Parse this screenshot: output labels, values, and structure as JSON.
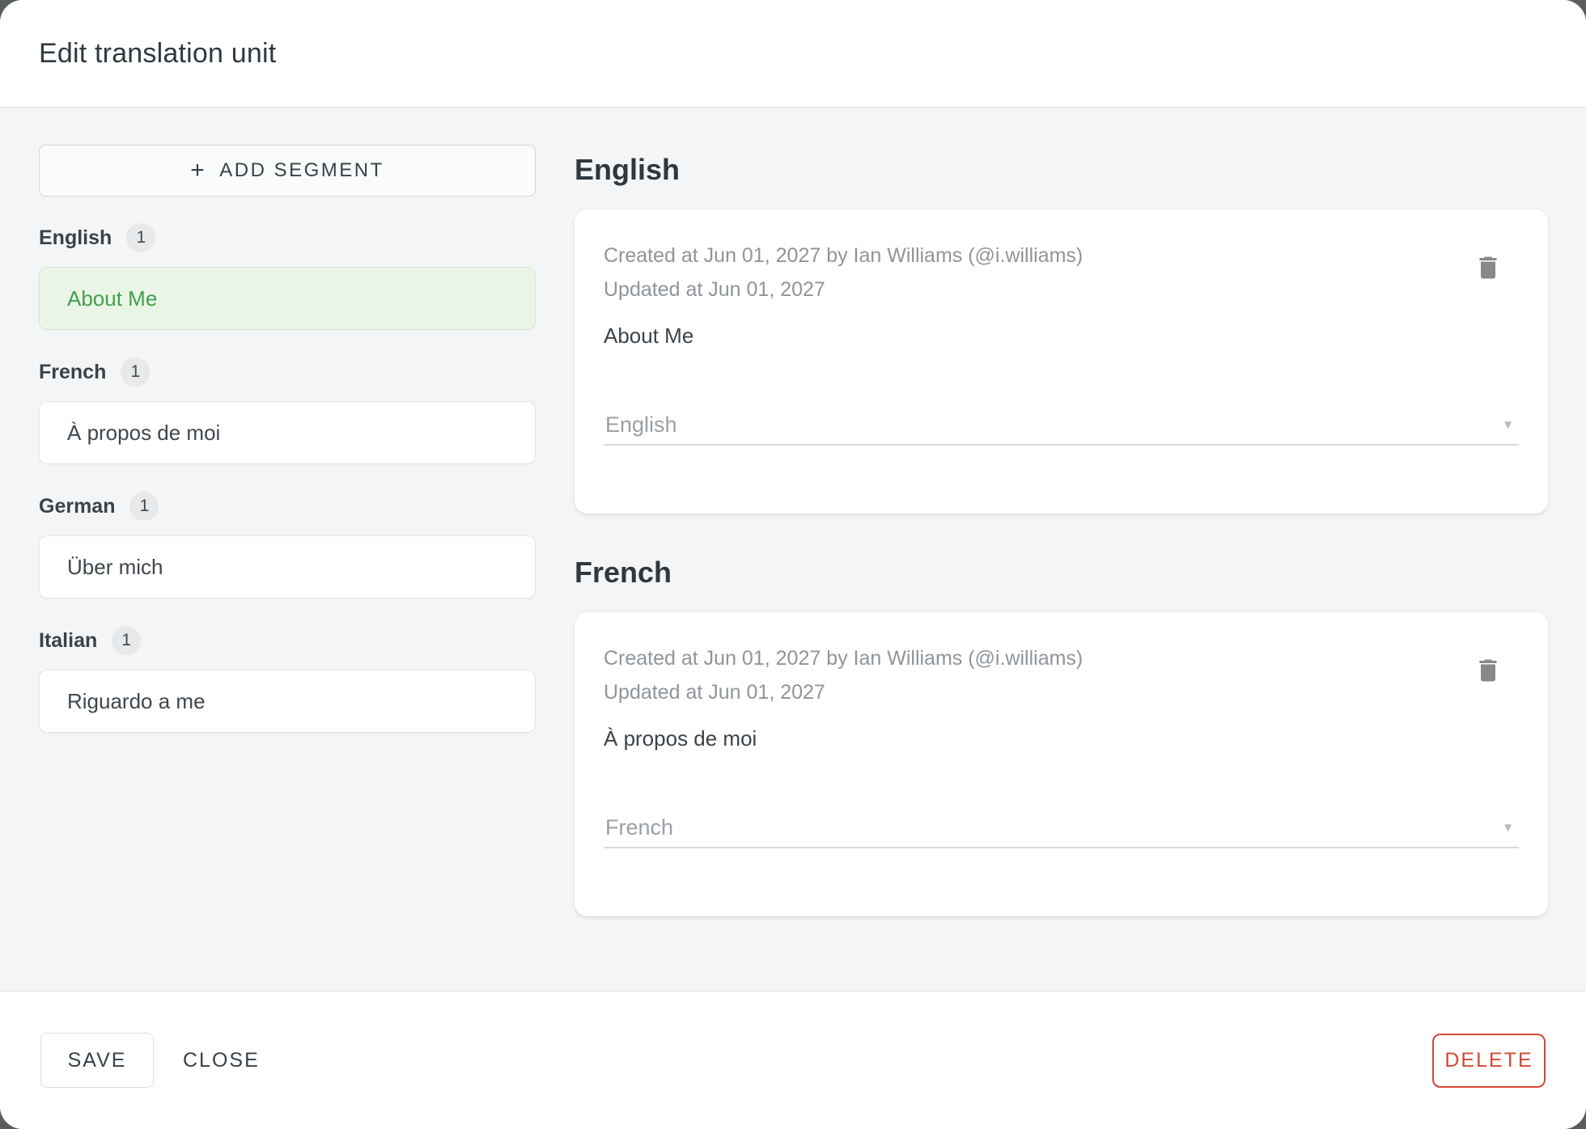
{
  "dialog": {
    "title": "Edit translation unit"
  },
  "sidebar": {
    "add_segment": {
      "label": "ADD SEGMENT",
      "plus_icon": "+"
    },
    "groups": [
      {
        "language": "English",
        "count": "1",
        "text": "About Me",
        "active": true
      },
      {
        "language": "French",
        "count": "1",
        "text": "À propos de moi",
        "active": false
      },
      {
        "language": "German",
        "count": "1",
        "text": "Über mich",
        "active": false
      },
      {
        "language": "Italian",
        "count": "1",
        "text": "Riguardo a me",
        "active": false
      }
    ]
  },
  "main": {
    "sections": [
      {
        "heading": "English",
        "created": "Created at Jun 01, 2027 by Ian Williams (@i.williams)",
        "updated": "Updated at Jun 01, 2027",
        "text": "About Me",
        "language_select": "English",
        "chevron_icon": "▼"
      },
      {
        "heading": "French",
        "created": "Created at Jun 01, 2027 by Ian Williams (@i.williams)",
        "updated": "Updated at Jun 01, 2027",
        "text": "À propos de moi",
        "language_select": "French",
        "chevron_icon": "▼"
      }
    ]
  },
  "footer": {
    "save_label": "SAVE",
    "close_label": "CLOSE",
    "delete_label": "DELETE"
  },
  "colors": {
    "accent_green": "#43a047",
    "active_segment_bg": "#eaf5e8",
    "delete_red": "#d14836",
    "content_bg": "#f4f5f6",
    "backdrop": "#5a5d60"
  }
}
